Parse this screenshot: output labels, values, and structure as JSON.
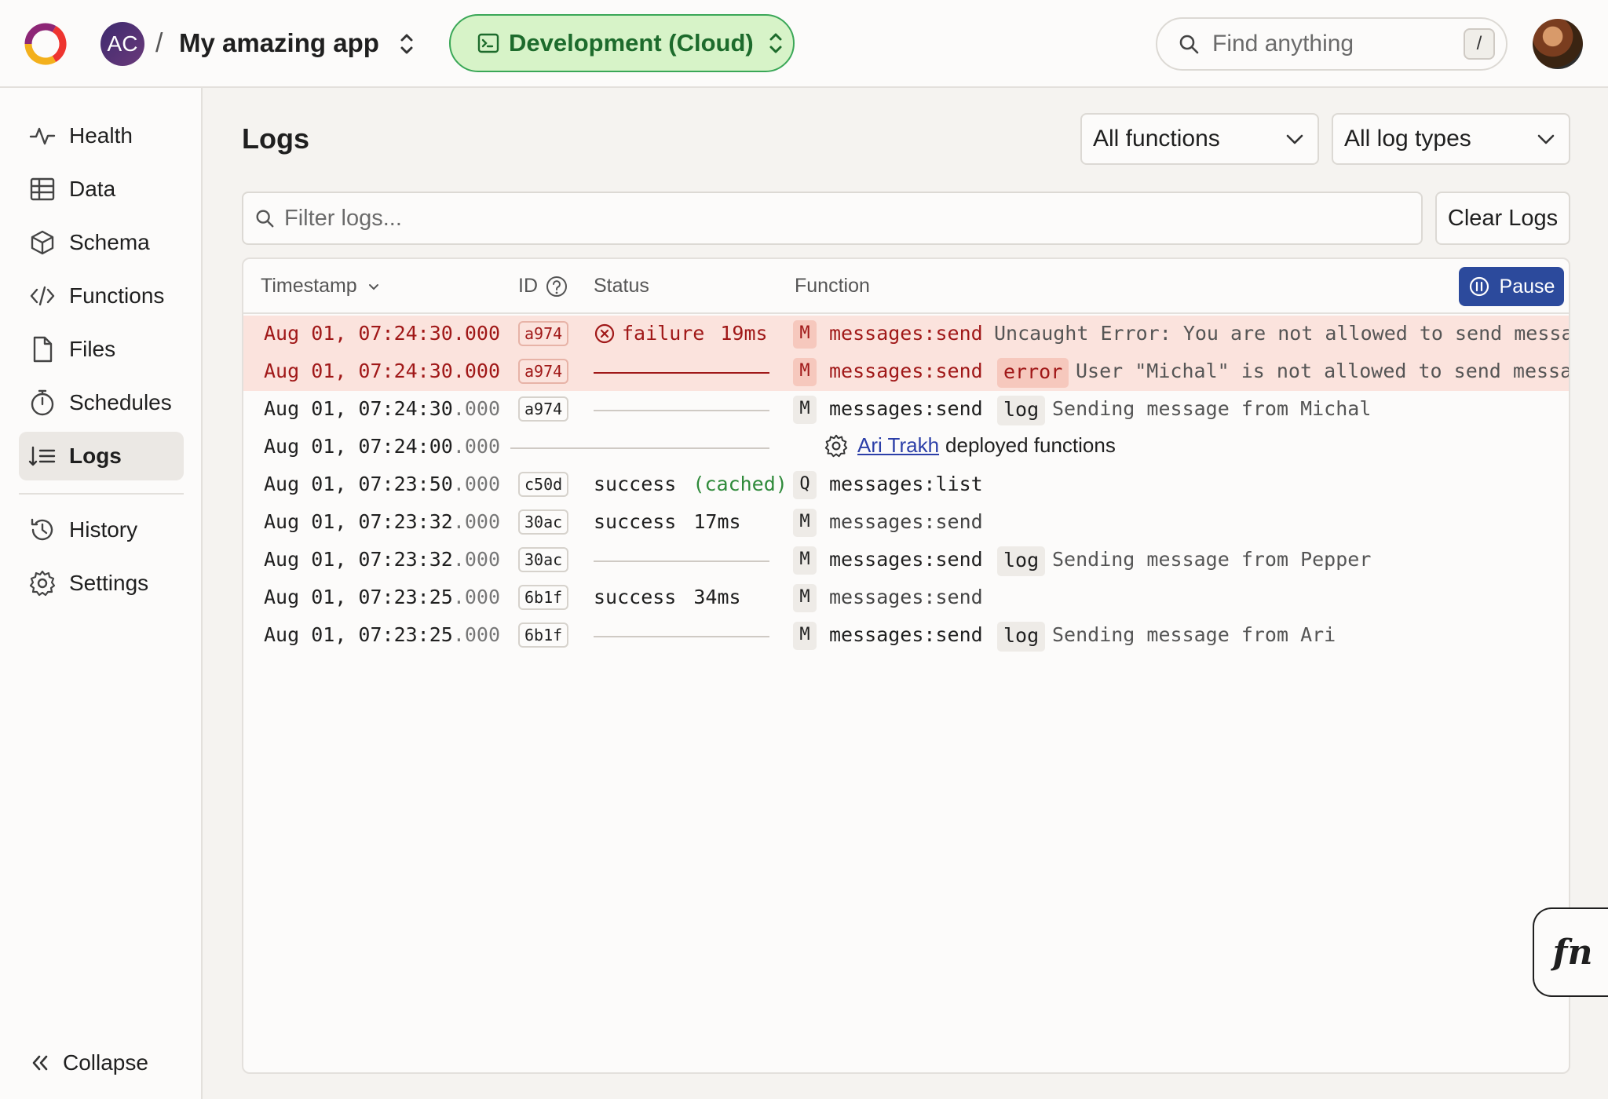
{
  "header": {
    "team_initials": "AC",
    "separator": "/",
    "project_name": "My amazing app",
    "deployment_label": "Development (Cloud)",
    "search_placeholder": "Find anything",
    "search_shortcut": "/"
  },
  "sidebar": {
    "items": [
      {
        "label": "Health",
        "icon": "pulse-icon"
      },
      {
        "label": "Data",
        "icon": "table-icon"
      },
      {
        "label": "Schema",
        "icon": "cube-icon"
      },
      {
        "label": "Functions",
        "icon": "code-icon"
      },
      {
        "label": "Files",
        "icon": "file-icon"
      },
      {
        "label": "Schedules",
        "icon": "stopwatch-icon"
      },
      {
        "label": "Logs",
        "icon": "list-sort-icon",
        "active": true
      },
      {
        "label": "History",
        "icon": "history-icon"
      },
      {
        "label": "Settings",
        "icon": "gear-icon"
      }
    ],
    "collapse_label": "Collapse"
  },
  "main": {
    "title": "Logs",
    "function_filter": "All functions",
    "logtype_filter": "All log types",
    "filter_placeholder": "Filter logs...",
    "clear_label": "Clear Logs",
    "columns": {
      "timestamp": "Timestamp",
      "id": "ID",
      "status": "Status",
      "function": "Function"
    },
    "pause_label": "Pause"
  },
  "logs": [
    {
      "ts": "Aug 01, 07:24:30",
      "ms": ".000",
      "id": "a974",
      "status": "failure",
      "duration": "19ms",
      "ftype": "M",
      "fname": "messages:send",
      "tag": "",
      "msg": "Uncaught Error: You are not allowed to send messa…",
      "error": true
    },
    {
      "ts": "Aug 01, 07:24:30",
      "ms": ".000",
      "id": "a974",
      "status": "",
      "duration": "",
      "ftype": "M",
      "fname": "messages:send",
      "tag": "error",
      "msg": "User \"Michal\" is not allowed to send messa…",
      "error": true
    },
    {
      "ts": "Aug 01, 07:24:30",
      "ms": ".000",
      "id": "a974",
      "status": "",
      "duration": "",
      "ftype": "M",
      "fname": "messages:send",
      "tag": "log",
      "msg": "Sending message from Michal"
    },
    {
      "ts": "Aug 01, 07:24:00",
      "ms": ".000",
      "deploy_user": "Ari Trakh",
      "deploy_text": "deployed functions"
    },
    {
      "ts": "Aug 01, 07:23:50",
      "ms": ".000",
      "id": "c50d",
      "status": "success",
      "duration": "(cached)",
      "ftype": "Q",
      "fname": "messages:list",
      "tag": "",
      "msg": ""
    },
    {
      "ts": "Aug 01, 07:23:32",
      "ms": ".000",
      "id": "30ac",
      "status": "success",
      "duration": "17ms",
      "ftype": "M",
      "fname": "messages:send",
      "tag": "",
      "msg": ""
    },
    {
      "ts": "Aug 01, 07:23:32",
      "ms": ".000",
      "id": "30ac",
      "status": "",
      "duration": "",
      "ftype": "M",
      "fname": "messages:send",
      "tag": "log",
      "msg": "Sending message from Pepper"
    },
    {
      "ts": "Aug 01, 07:23:25",
      "ms": ".000",
      "id": "6b1f",
      "status": "success",
      "duration": "34ms",
      "ftype": "M",
      "fname": "messages:send",
      "tag": "",
      "msg": ""
    },
    {
      "ts": "Aug 01, 07:23:25",
      "ms": ".000",
      "id": "6b1f",
      "status": "",
      "duration": "",
      "ftype": "M",
      "fname": "messages:send",
      "tag": "log",
      "msg": "Sending message from Ari"
    }
  ],
  "fn_button": "fn",
  "colors": {
    "accent_green": "#3aa757",
    "pause_blue": "#2c4a9c",
    "error_red": "#a01818",
    "error_bg": "#fbe3dd"
  }
}
